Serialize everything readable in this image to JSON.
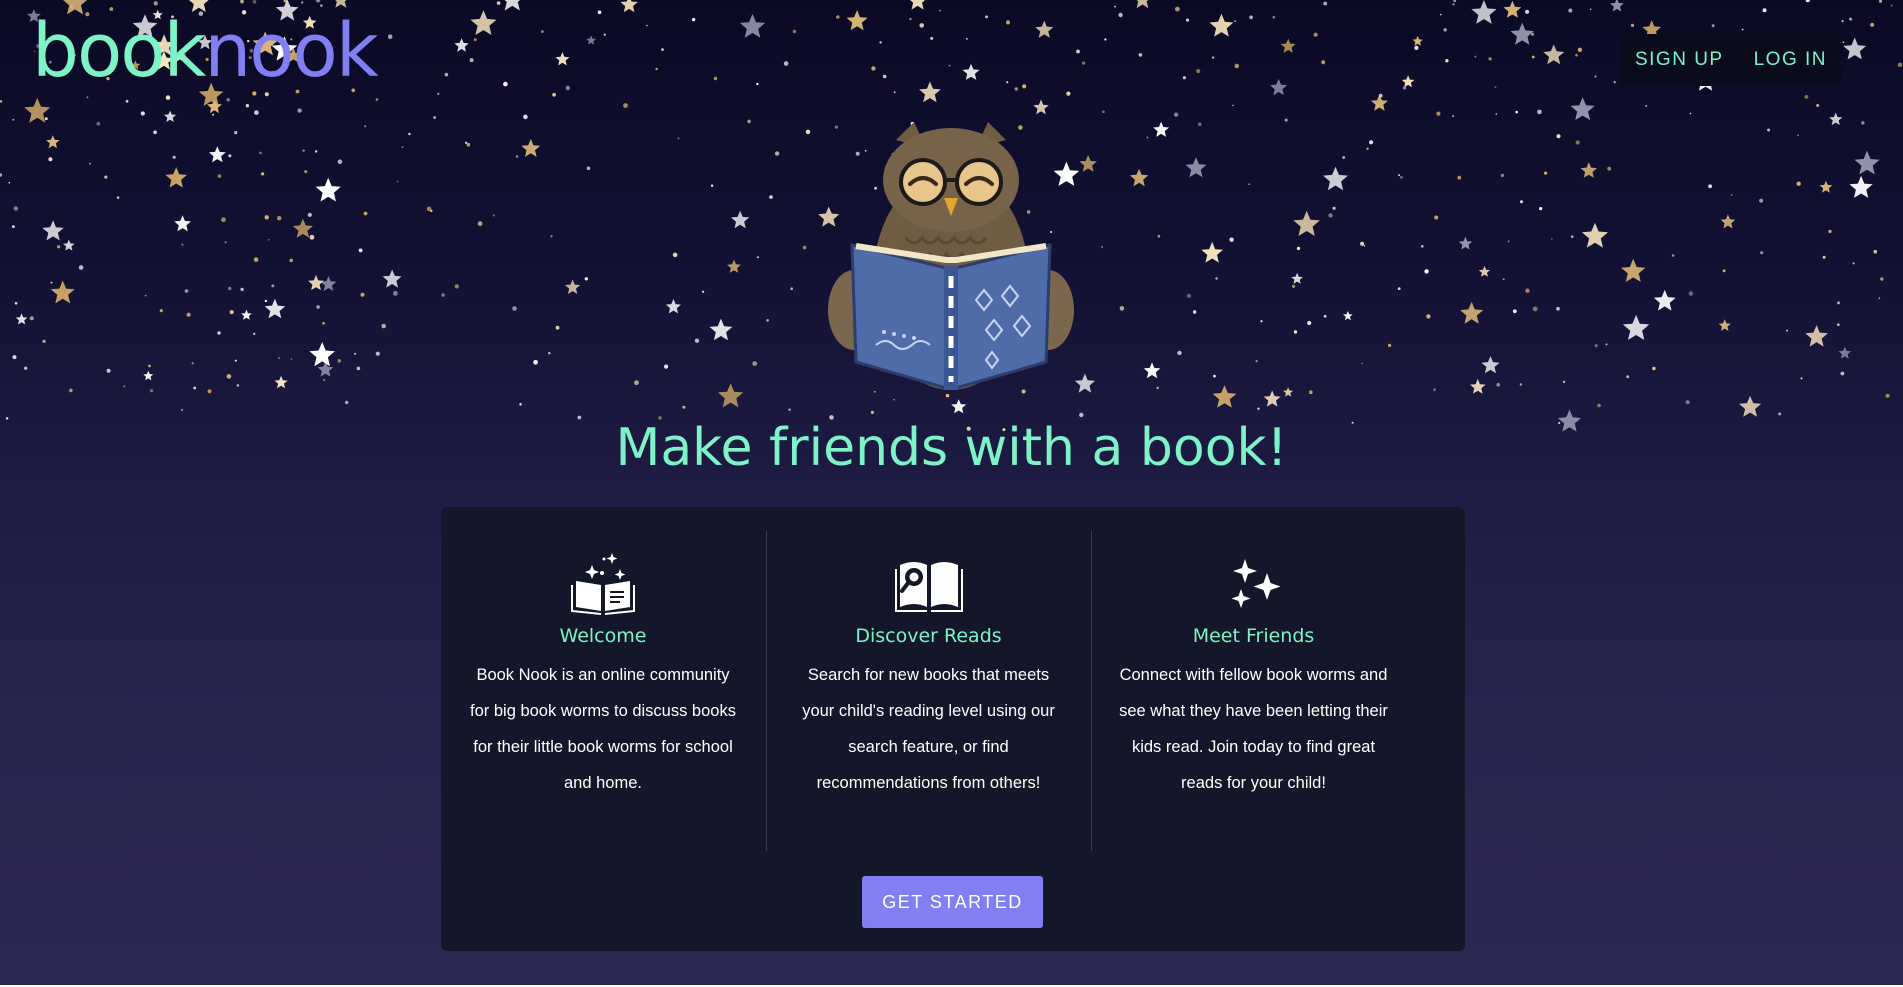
{
  "logo": {
    "part1": "book",
    "part2": "nook"
  },
  "nav": {
    "signup": "SIGN UP",
    "login": "LOG IN"
  },
  "hero": {
    "headline": "Make friends with a book!"
  },
  "features": [
    {
      "icon": "open-book-sparkle-icon",
      "title": "Welcome",
      "text": "Book Nook is an online community for big book worms to discuss books for their little book worms for school and home."
    },
    {
      "icon": "book-search-icon",
      "title": "Discover Reads",
      "text": "Search for new books that meets your child's reading level using our search feature, or find recommendations from others!"
    },
    {
      "icon": "sparkles-icon",
      "title": "Meet Friends",
      "text": "Connect with fellow book worms and see what they have been letting their kids read. Join today to find great reads for your child!"
    }
  ],
  "cta": {
    "label": "GET STARTED"
  },
  "colors": {
    "mint": "#7ef3c8",
    "lavender": "#8080f2",
    "navy": "#0b0a25",
    "card": "#141729"
  }
}
